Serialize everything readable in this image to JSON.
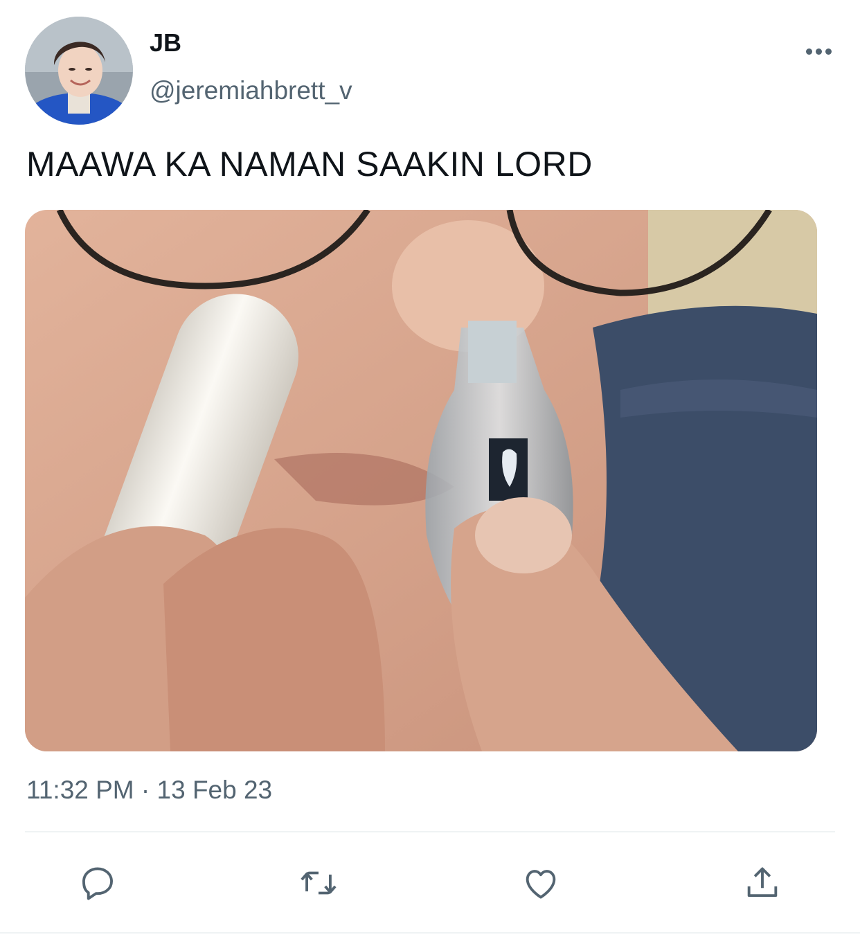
{
  "tweet": {
    "author": {
      "display_name": "JB",
      "handle": "@jeremiahbrett_v"
    },
    "text": "MAAWA KA NAMAN SAAKIN LORD",
    "timestamp": "11:32 PM · 13 Feb 23"
  },
  "icons": {
    "more": "more-horizontal-icon",
    "reply": "reply-icon",
    "retweet": "retweet-icon",
    "like": "heart-icon",
    "share": "share-icon"
  },
  "colors": {
    "text_primary": "#0f1419",
    "text_secondary": "#536471",
    "divider": "#eff3f4"
  }
}
